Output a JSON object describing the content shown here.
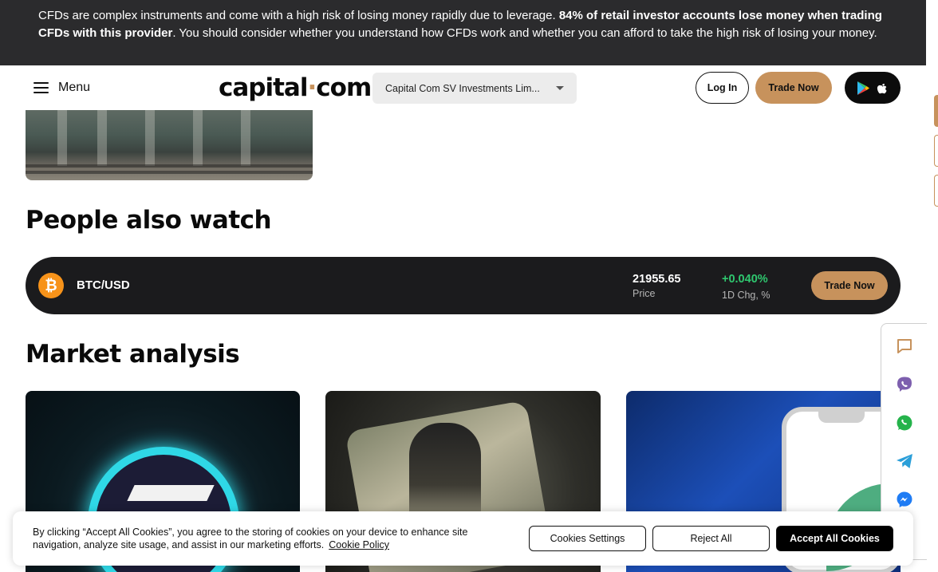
{
  "risk_banner": {
    "text_start": "CFDs are complex instruments and come with a high risk of losing money rapidly due to leverage. ",
    "text_bold": "84% of retail investor accounts lose money when trading CFDs with this provider",
    "text_end": ". You should consider whether you understand how CFDs work and whether you can afford to take the high risk of losing your money."
  },
  "header": {
    "menu_label": "Menu",
    "logo_text_a": "capital",
    "logo_dot": "·",
    "logo_text_b": "com",
    "entity_select": "Capital Com SV Investments Lim...",
    "login_label": "Log In",
    "trade_label": "Trade Now",
    "apps_icons": [
      "google-play-icon",
      "apple-icon"
    ]
  },
  "sections": {
    "people_also_watch": "People also watch",
    "market_analysis": "Market analysis"
  },
  "watch_list": [
    {
      "symbol_icon": "bitcoin-icon",
      "icon_glyph": "₿",
      "pair": "BTC/USD",
      "price": "21955.65",
      "price_label": "Price",
      "change": "+0.040%",
      "change_label": "1D Chg, %",
      "trade_label": "Trade Now"
    }
  ],
  "social_icons": [
    "chat-icon",
    "viber-icon",
    "whatsapp-icon",
    "telegram-icon",
    "messenger-icon"
  ],
  "cookie_banner": {
    "text": "By clicking “Accept All Cookies”, you agree to the storing of cookies on your device to enhance site navigation, analyze site usage, and assist in our marketing efforts.",
    "policy_link": "Cookie Policy",
    "settings_label": "Cookies Settings",
    "reject_label": "Reject All",
    "accept_label": "Accept All Cookies"
  },
  "colors": {
    "accent": "#c7925c",
    "banner_bg": "#2b2b2d",
    "row_bg": "#1b1b1d",
    "positive": "#2fc86f",
    "bitcoin": "#f7931a"
  }
}
